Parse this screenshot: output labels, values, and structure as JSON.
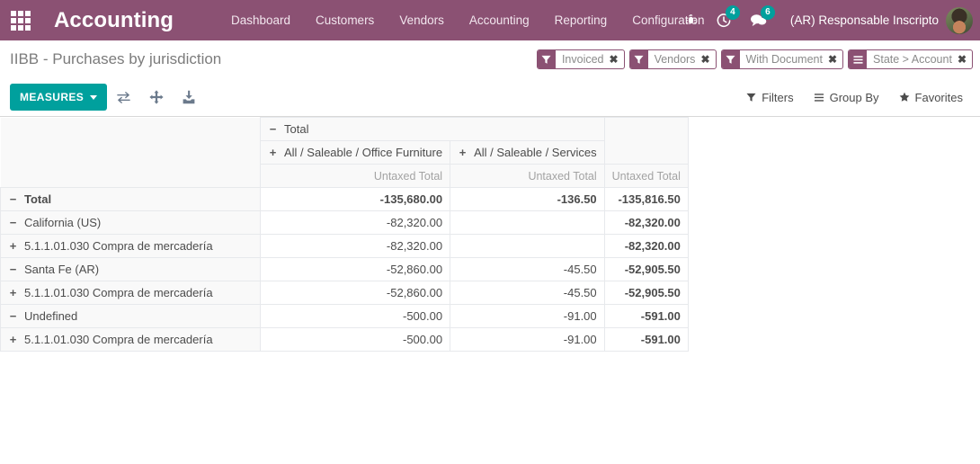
{
  "navbar": {
    "apps_icon": "apps-grid-icon",
    "brand": "Accounting",
    "menus": [
      "Dashboard",
      "Customers",
      "Vendors",
      "Accounting",
      "Reporting",
      "Configuration"
    ],
    "debug_icon": "bug-icon",
    "activity_icon": "clock-icon",
    "activity_count": "4",
    "messages_icon": "chat-icon",
    "messages_count": "6",
    "user_name": "(AR) Responsable Inscripto",
    "avatar_icon": "user-avatar",
    "bg_color": "#8b5173",
    "badge_color": "#00a09d"
  },
  "control_panel": {
    "breadcrumb": "IIBB - Purchases by jurisdiction",
    "facets": [
      {
        "icon": "filter-icon",
        "label": "Invoiced",
        "remove": "✖"
      },
      {
        "icon": "filter-icon",
        "label": "Vendors",
        "remove": "✖"
      },
      {
        "icon": "filter-icon",
        "label": "With Document",
        "remove": "✖"
      },
      {
        "icon": "groupby-icon",
        "label": "State > Account",
        "remove": "✖"
      }
    ],
    "measures_label": "MEASURES",
    "measures_color": "#00a09d",
    "tools": [
      {
        "icon": "flip-axis-icon",
        "title": "Flip axis"
      },
      {
        "icon": "expand-all-icon",
        "title": "Expand all"
      },
      {
        "icon": "download-xlsx-icon",
        "title": "Download xlsx"
      }
    ],
    "searchbar": [
      {
        "icon": "filter-icon",
        "label": "Filters"
      },
      {
        "icon": "groupby-icon",
        "label": "Group By"
      },
      {
        "icon": "star-icon",
        "label": "Favorites"
      }
    ]
  },
  "pivot": {
    "col_root": {
      "toggle": "−",
      "label": "Total"
    },
    "col_groups": [
      {
        "toggle": "+",
        "label": "All / Saleable / Office Furniture"
      },
      {
        "toggle": "+",
        "label": "All / Saleable / Services"
      }
    ],
    "measure_headers": [
      "Untaxed Total",
      "Untaxed Total",
      "Untaxed Total"
    ],
    "rows": [
      {
        "toggle": "−",
        "label": "Total",
        "indent": 0,
        "total": true,
        "values": [
          "-135,680.00",
          "-136.50",
          "-135,816.50"
        ]
      },
      {
        "toggle": "−",
        "label": "California (US)",
        "indent": 1,
        "total": false,
        "values": [
          "-82,320.00",
          "",
          "-82,320.00"
        ]
      },
      {
        "toggle": "+",
        "label": "5.1.1.01.030 Compra de mercadería",
        "indent": 2,
        "total": false,
        "values": [
          "-82,320.00",
          "",
          "-82,320.00"
        ]
      },
      {
        "toggle": "−",
        "label": "Santa Fe (AR)",
        "indent": 1,
        "total": false,
        "values": [
          "-52,860.00",
          "-45.50",
          "-52,905.50"
        ]
      },
      {
        "toggle": "+",
        "label": "5.1.1.01.030 Compra de mercadería",
        "indent": 2,
        "total": false,
        "values": [
          "-52,860.00",
          "-45.50",
          "-52,905.50"
        ]
      },
      {
        "toggle": "−",
        "label": "Undefined",
        "indent": 1,
        "total": false,
        "values": [
          "-500.00",
          "-91.00",
          "-591.00"
        ]
      },
      {
        "toggle": "+",
        "label": "5.1.1.01.030 Compra de mercadería",
        "indent": 2,
        "total": false,
        "values": [
          "-500.00",
          "-91.00",
          "-591.00"
        ]
      }
    ]
  }
}
